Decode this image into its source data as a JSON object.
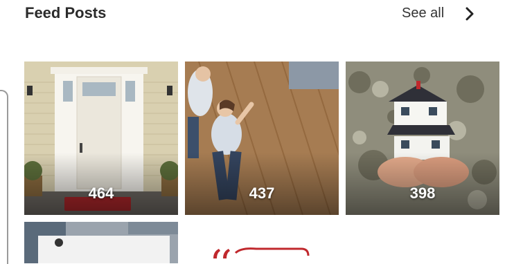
{
  "header": {
    "title": "Feed Posts",
    "see_all_label": "See all"
  },
  "posts": [
    {
      "count": "464",
      "subject": "front-door-porch"
    },
    {
      "count": "437",
      "subject": "couple-on-wood-floor"
    },
    {
      "count": "398",
      "subject": "hands-holding-house"
    },
    {
      "count": "",
      "subject": "partial-fourth-post"
    }
  ],
  "colors": {
    "title": "#2b2b2b",
    "accent_red": "#c0282d"
  }
}
